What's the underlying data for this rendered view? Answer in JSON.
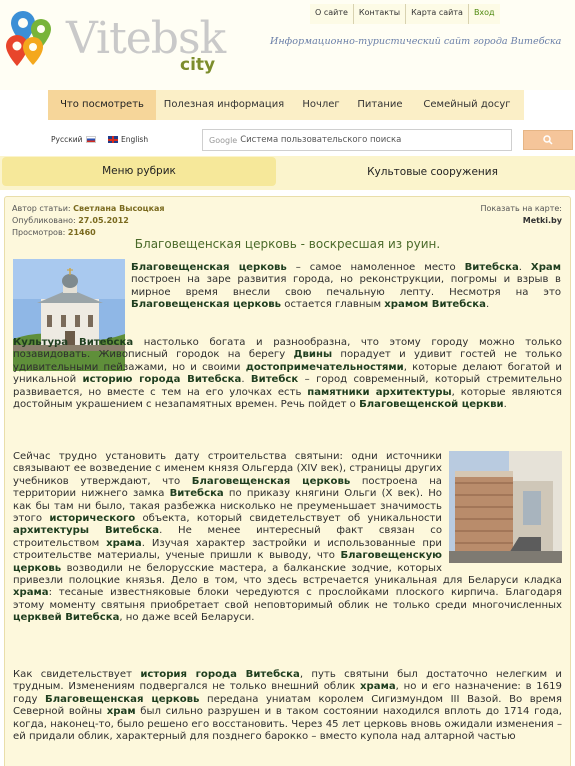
{
  "logo": {
    "word": "Vitebsk",
    "sub": "city"
  },
  "top_menu": [
    "О сайте",
    "Контакты",
    "Карта сайта",
    "Вход"
  ],
  "tagline": "Информационно-туристический  сайт  города Витебска",
  "nav": [
    "Что посмотреть",
    "Полезная информация",
    "Ночлег",
    "Питание",
    "Семейный досуг"
  ],
  "lang": {
    "ru": "Русский",
    "en": "English"
  },
  "search": {
    "google": "Google",
    "placeholder": "Система пользовательского поиска"
  },
  "rubrics": {
    "menu": "Меню рубрик",
    "current": "Культовые сооружения"
  },
  "article": {
    "author_label": "Автор статьи:",
    "author": "Светлана Высоцкая",
    "published_label": "Опубликовано:",
    "published": "27.05.2012",
    "views_label": "Просмотров:",
    "views": "21460",
    "map_label": "Показать на карте:",
    "map_site": "Metki.by",
    "title": "Благовещенская церковь - воскресшая из руин.",
    "p1": "<b>Благовещенская церковь</b> – самое намоленное место <b>Витебска</b>. <b>Храм</b> построен на заре развития города, но реконструкции, погромы и взрыв в мирное время внесли свою печальную лепту. Несмотря на это <b>Благовещенская церковь</b> остается главным <b>храмом Витебска</b>.",
    "p2": "<b>Культура Витебска</b> настолько богата и разнообразна, что этому городу можно только позавидовать. Живописный городок на берегу <b>Двины</b> порадует и удивит гостей не только удивительными пейзажами, но и своими <b>достопримечательностями</b>, которые делают богатой и уникальной <b>историю города Витебска</b>. <b>Витебск</b> – город современный, который стремительно развивается, но вместе с тем на его улочках есть <b>памятники архитектуры</b>, которые являются достойным украшением с незапамятных времен. Речь пойдет о <b>Благовещенской церкви</b>.",
    "p3": "Сейчас трудно установить дату строительства святыни: одни источники связывают ее возведение с именем князя Ольгерда (XIV век), страницы других учебников утверждают, что <b>Благовещенская церковь</b> построена на территории нижнего замка <b>Витебска</b> по приказу княгини Ольги (X век). Но как бы там ни было, такая разбежка нисколько не преуменьшает значимость этого <b>исторического</b> объекта, который свидетельствует об уникальности <b>архитектуры Витебска</b>. Не менее интересный факт связан со строительством <b>храма</b>. Изучая характер застройки и использованные при строительстве материалы, ученые пришли к выводу, что <b>Благовещенскую церковь</b> возводили не белорусские мастера, а балканские зодчие, которых привезли полоцкие князья. Дело в том, что здесь встречается уникальная для Беларуси кладка <b>храма</b>: тесаные известняковые блоки чередуются с прослойками плоского кирпича. Благодаря этому моменту святыня приобретает свой неповторимый облик не только среди многочисленных <b>церквей Витебска</b>, но даже всей Беларуси.",
    "p4": "Как свидетельствует <b>история города Витебска</b>, путь святыни был достаточно нелегким и трудным. Изменениям подвергался не только внешний облик <b>храма</b>, но и его назначение: в 1619 году <b>Благовещенская церковь</b> передана униатам королем Сигизмундом III Вазой. Во время Северной войны <b>храм</b> был сильно разрушен и в таком состоянии находился вплоть до 1714 года, когда, наконец-то, было решено его восстановить. Через 45 лет церковь вновь ожидали изменения – ей придали облик, характерный для позднего барокко – вместо купола над алтарной частью"
  }
}
